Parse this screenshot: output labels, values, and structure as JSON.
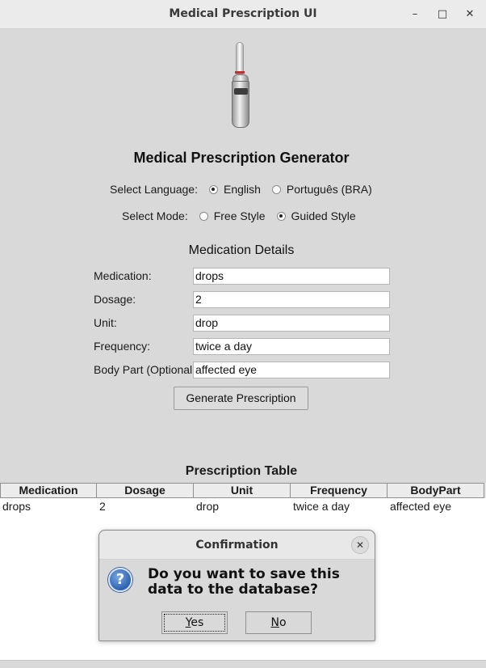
{
  "window": {
    "title": "Medical Prescription UI",
    "controls": {
      "minimize": "–",
      "maximize": "□",
      "close": "✕"
    }
  },
  "header": {
    "logo": "vial-icon",
    "title": "Medical Prescription Generator"
  },
  "language": {
    "label": "Select Language:",
    "options": [
      "English",
      "Português (BRA)"
    ],
    "selected": "English"
  },
  "mode": {
    "label": "Select Mode:",
    "options": [
      "Free Style",
      "Guided Style"
    ],
    "selected": "Guided Style"
  },
  "details": {
    "title": "Medication Details",
    "fields": [
      {
        "label": "Medication:",
        "value": "drops"
      },
      {
        "label": "Dosage:",
        "value": "2"
      },
      {
        "label": "Unit:",
        "value": "drop"
      },
      {
        "label": "Frequency:",
        "value": "twice a day"
      },
      {
        "label": "Body Part (Optional):",
        "value": "affected eye"
      }
    ],
    "generate_button": "Generate Prescription"
  },
  "table": {
    "title": "Prescription Table",
    "columns": [
      "Medication",
      "Dosage",
      "Unit",
      "Frequency",
      "BodyPart"
    ],
    "rows": [
      [
        "drops",
        "2",
        "drop",
        "twice a day",
        "affected eye"
      ]
    ]
  },
  "dialog": {
    "title": "Confirmation",
    "close": "✕",
    "icon": "question-icon",
    "message": "Do you want to save this data to the database?",
    "yes_label": "es",
    "yes_mnemonic": "Y",
    "no_label": "o",
    "no_mnemonic": "N"
  }
}
